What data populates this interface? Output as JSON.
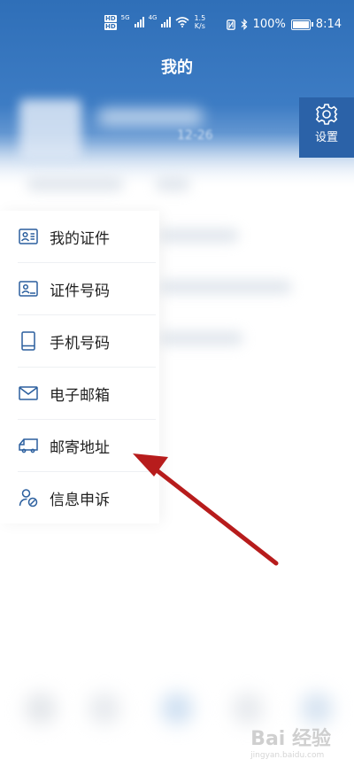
{
  "status_bar": {
    "hd_top": "HD",
    "hd_bottom": "HD",
    "network": "5G",
    "network2": "4G",
    "speed_value": "1.5",
    "speed_unit": "K/s",
    "battery": "100%",
    "time": "8:14"
  },
  "header": {
    "title": "我的",
    "date_fragment": "12-26",
    "settings_label": "设置"
  },
  "menu": {
    "items": [
      {
        "label": "我的证件",
        "icon": "id-card-icon"
      },
      {
        "label": "证件号码",
        "icon": "id-number-icon"
      },
      {
        "label": "手机号码",
        "icon": "phone-icon"
      },
      {
        "label": "电子邮箱",
        "icon": "mail-icon"
      },
      {
        "label": "邮寄地址",
        "icon": "truck-icon"
      },
      {
        "label": "信息申诉",
        "icon": "user-appeal-icon"
      }
    ]
  },
  "watermark": {
    "text": "Bai 经验",
    "url": "jingyan.baidu.com"
  },
  "colors": {
    "header_blue": "#2f6fb8",
    "settings_bg": "#2b62a8",
    "icon_blue": "#2b5f9e",
    "arrow_red": "#b71c1c"
  }
}
